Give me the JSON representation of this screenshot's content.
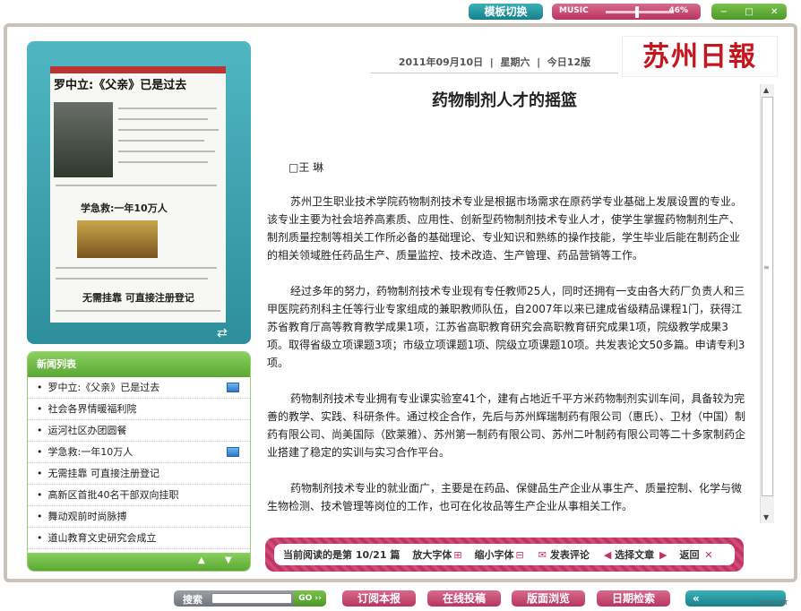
{
  "topbar": {
    "switch_label": "模板切换",
    "music_label": "MUSIC",
    "music_volume": "46%",
    "music_volume_level": 0.46,
    "window_buttons": [
      "−",
      "□",
      "✕"
    ]
  },
  "masthead": {
    "date": "2011年09月10日",
    "weekday": "星期六",
    "edition": "今日12版",
    "logo_text": "苏州日報"
  },
  "paper_preview": {
    "headline": "罗中立:《父亲》已是过去",
    "headline2": "学急救:一年10万人",
    "headline3": "无需挂靠 可直接注册登记"
  },
  "news": {
    "header": "新闻列表",
    "items": [
      {
        "title": "罗中立:《父亲》已是过去",
        "media": true
      },
      {
        "title": "社会各界情暖福利院",
        "media": false
      },
      {
        "title": "运河社区办团圆餐",
        "media": false
      },
      {
        "title": "学急救:一年10万人",
        "media": true
      },
      {
        "title": "无需挂靠  可直接注册登记",
        "media": false
      },
      {
        "title": "高新区首批40名干部双向挂职",
        "media": false
      },
      {
        "title": "舞动观前时尚脉搏",
        "media": false
      },
      {
        "title": "道山教育文史研究会成立",
        "media": false
      }
    ]
  },
  "article": {
    "title": "药物制剂人才的摇篮",
    "author": "□王  琳",
    "paragraphs": [
      "苏州卫生职业技术学院药物制剂技术专业是根据市场需求在原药学专业基础上发展设置的专业。该专业主要为社会培养高素质、应用性、创新型药物制剂技术专业人才，使学生掌握药物制剂生产、制剂质量控制等相关工作所必备的基础理论、专业知识和熟练的操作技能，学生毕业后能在制药企业的相关领域胜任药品生产、质量监控、技术改造、生产管理、药品营销等工作。",
      "经过多年的努力，药物制剂技术专业现有专任教师25人，同时还拥有一支由各大药厂负责人和三甲医院药剂科主任等行业专家组成的兼职教师队伍，自2007年以来已建成省级精品课程1门，获得江苏省教育厅高等教育教学成果1项，江苏省高职教育研究会高职教育研究成果1项，院级教学成果3项。取得省级立项课题3项；市级立项课题1项、院级立项课题10项。共发表论文50多篇。申请专利3项。",
      "药物制剂技术专业拥有专业课实验室41个，建有占地近千平方米药物制剂实训车间，具备较为完善的教学、实践、科研条件。通过校企合作，先后与苏州辉瑞制药有限公司（惠氏）、卫材（中国）制药有限公司、尚美国际（欧莱雅）、苏州第一制药有限公司、苏州二叶制药有限公司等二十多家制药企业搭建了稳定的实训与实习合作平台。",
      "药物制剂技术专业的就业面广，主要是在药品、保健品生产企业从事生产、质量控制、化学与微生物检测、技术管理等岗位的工作，也可在化妆品等生产企业从事相关工作。"
    ]
  },
  "readbar": {
    "current_label": "当前阅读的是第",
    "position": "10/21",
    "unit": "篇",
    "enlarge": "放大字体",
    "shrink": "缩小字体",
    "comment": "发表评论",
    "select": "选择文章",
    "back": "返回"
  },
  "bottombar": {
    "search_label": "搜索",
    "search_go": "GO",
    "subscribe": "订阅本报",
    "submit": "在线投稿",
    "browse": "版面浏览",
    "date_search": "日期检索",
    "back_label": "«",
    "brand": "IUMS.NET"
  }
}
